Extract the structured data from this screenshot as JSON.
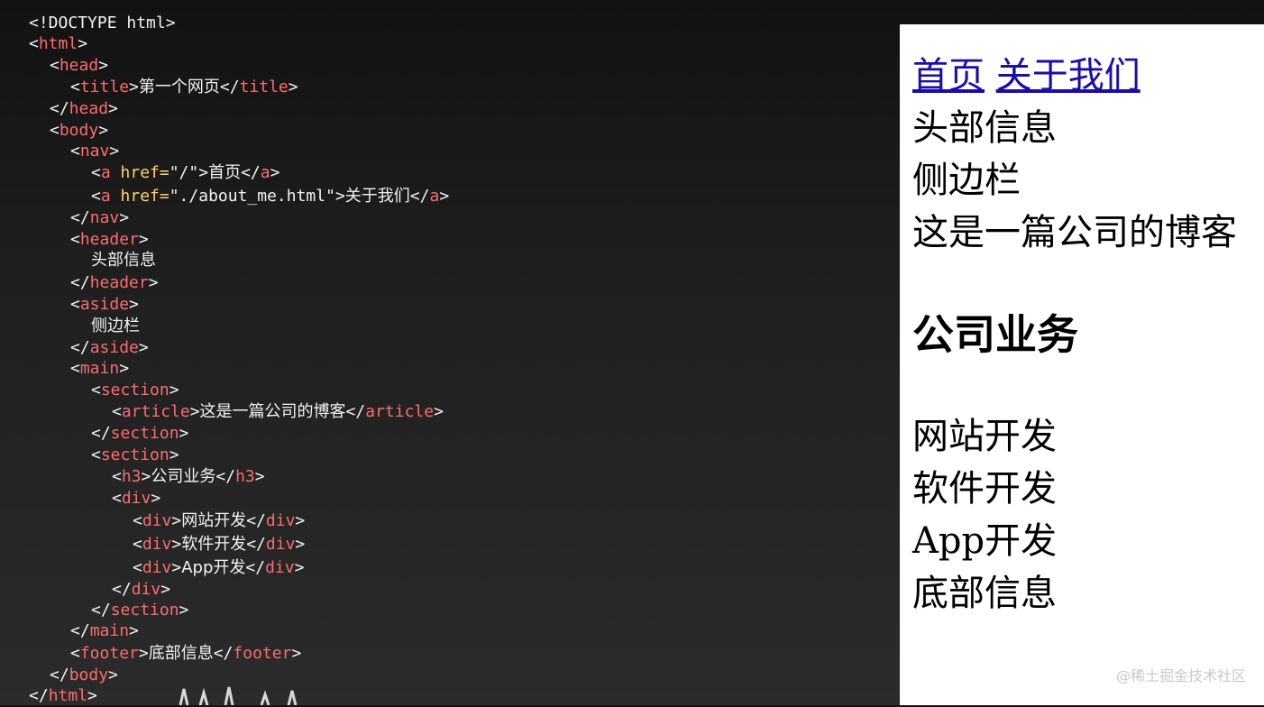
{
  "code": {
    "lines": [
      [
        "<!DOCTYPE html>"
      ],
      [
        "<",
        "html",
        ">"
      ],
      [
        "<",
        "head",
        ">"
      ],
      [
        "<",
        "title",
        ">",
        "第一个网页",
        "</",
        "title",
        ">"
      ],
      [
        "</",
        "head",
        ">"
      ],
      [
        "<",
        "body",
        ">"
      ],
      [
        "<",
        "nav",
        ">"
      ],
      [
        "<",
        "a",
        " href=",
        "\"/\"",
        ">",
        "首页",
        "</",
        "a",
        ">"
      ],
      [
        "<",
        "a",
        " href=",
        "\"./about_me.html\"",
        ">",
        "关于我们",
        "</",
        "a",
        ">"
      ],
      [
        "</",
        "nav",
        ">"
      ],
      [
        "<",
        "header",
        ">"
      ],
      [
        "头部信息"
      ],
      [
        "</",
        "header",
        ">"
      ],
      [
        "<",
        "aside",
        ">"
      ],
      [
        "侧边栏"
      ],
      [
        "</",
        "aside",
        ">"
      ],
      [
        "<",
        "main",
        ">"
      ],
      [
        "<",
        "section",
        ">"
      ],
      [
        "<",
        "article",
        ">",
        "这是一篇公司的博客",
        "</",
        "article",
        ">"
      ],
      [
        "</",
        "section",
        ">"
      ],
      [
        "<",
        "section",
        ">"
      ],
      [
        "<",
        "h3",
        ">",
        "公司业务",
        "</",
        "h3",
        ">"
      ],
      [
        "<",
        "div",
        ">"
      ],
      [
        "<",
        "div",
        ">",
        "网站开发",
        "</",
        "div",
        ">"
      ],
      [
        "<",
        "div",
        ">",
        "软件开发",
        "</",
        "div",
        ">"
      ],
      [
        "<",
        "div",
        ">",
        "App开发",
        "</",
        "div",
        ">"
      ],
      [
        "</",
        "div",
        ">"
      ],
      [
        "</",
        "section",
        ">"
      ],
      [
        "</",
        "main",
        ">"
      ],
      [
        "<",
        "footer",
        ">",
        "底部信息",
        "</",
        "footer",
        ">"
      ],
      [
        "</",
        "body",
        ">"
      ],
      [
        "</",
        "html",
        ">"
      ]
    ]
  },
  "preview": {
    "nav": {
      "home": "首页",
      "about": "关于我们"
    },
    "header": "头部信息",
    "aside": "侧边栏",
    "article": "这是一篇公司的博客",
    "h3": "公司业务",
    "items": [
      "网站开发",
      "软件开发",
      "App开发"
    ],
    "footer": "底部信息"
  },
  "watermark": "@稀土掘金技术社区",
  "colors": {
    "tag": "#ff6b6b",
    "attr": "#ffd166",
    "link": "#1a0dab"
  }
}
